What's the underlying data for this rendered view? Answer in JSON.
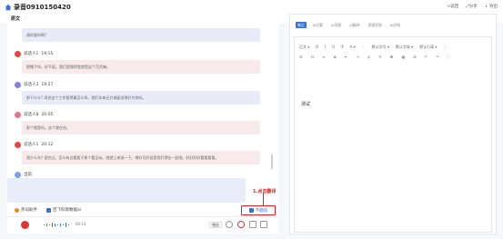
{
  "header": {
    "title": "录音0910150420",
    "actions": [
      "<返回",
      "⤢分享",
      "↓ 导出"
    ]
  },
  "subheader": {
    "label": "原文",
    "chevron": "›"
  },
  "transcript": [
    {
      "speaker": "",
      "time": "",
      "text": "请你要吗啊?",
      "color": "#e9ecf8",
      "avatar_color": "#8a7fd6"
    },
    {
      "speaker": "说话人1",
      "time": "19:15",
      "text": "那帽子吗，好不起。我们是替得我就是这个百货嘛。",
      "color": "#f7e9ec",
      "avatar_color": "#e04848"
    },
    {
      "speaker": "说话人3",
      "time": "19:27",
      "text": "那干什么? 用你这个工作管得事怎么样。我们本来还方城厦说得好为你吗。",
      "color": "#e9ecf8",
      "avatar_color": "#8a7fd6"
    },
    {
      "speaker": "说话人8",
      "time": "20:05",
      "text": "那个就是吗。这个就在由。",
      "color": "#f7e9ec",
      "avatar_color": "#e07890"
    },
    {
      "speaker": "说话人1",
      "time": "20:12",
      "text": "我什么东? 说完过。怎么有点看要干那个看见似。就就上来说一下。哪好可好说是我们得在一起吧。好好好好看看看看。",
      "color": "#f7e9ec",
      "avatar_color": "#e04848"
    }
  ],
  "live": {
    "label": "当前",
    "avatar_color": "#7ea0e8"
  },
  "annotation": {
    "text": "1.点击翻译",
    "button_label": "不翻译"
  },
  "bottom_toolbar": [
    {
      "label": "热词助手",
      "color": "#e98a2a"
    },
    {
      "label": "百飞科目数据ai",
      "color": "#3a6fd8"
    }
  ],
  "player": {
    "time": "00:14",
    "speed_label": "播放"
  },
  "right_panel": {
    "tabs": [
      "笔记",
      "AI纪要",
      "AI导图",
      "AI翻译",
      "思维导图",
      "AI总结"
    ],
    "active_tab": 0,
    "toolbar_row1": [
      "正文 ▾",
      "B",
      "I",
      "U",
      "T̶",
      "A ▾",
      "⋯",
      "默认字号 ▾",
      "默认字体 ▾",
      "默认行高 ▾",
      "⋮"
    ],
    "toolbar_row2": [
      "☰",
      "☷",
      "≡",
      "≣",
      "⇤",
      "⇥",
      "◎",
      "✎",
      "⌘",
      "▦",
      "⊞",
      "↶",
      "↷",
      "⛶"
    ],
    "content": "测试"
  }
}
